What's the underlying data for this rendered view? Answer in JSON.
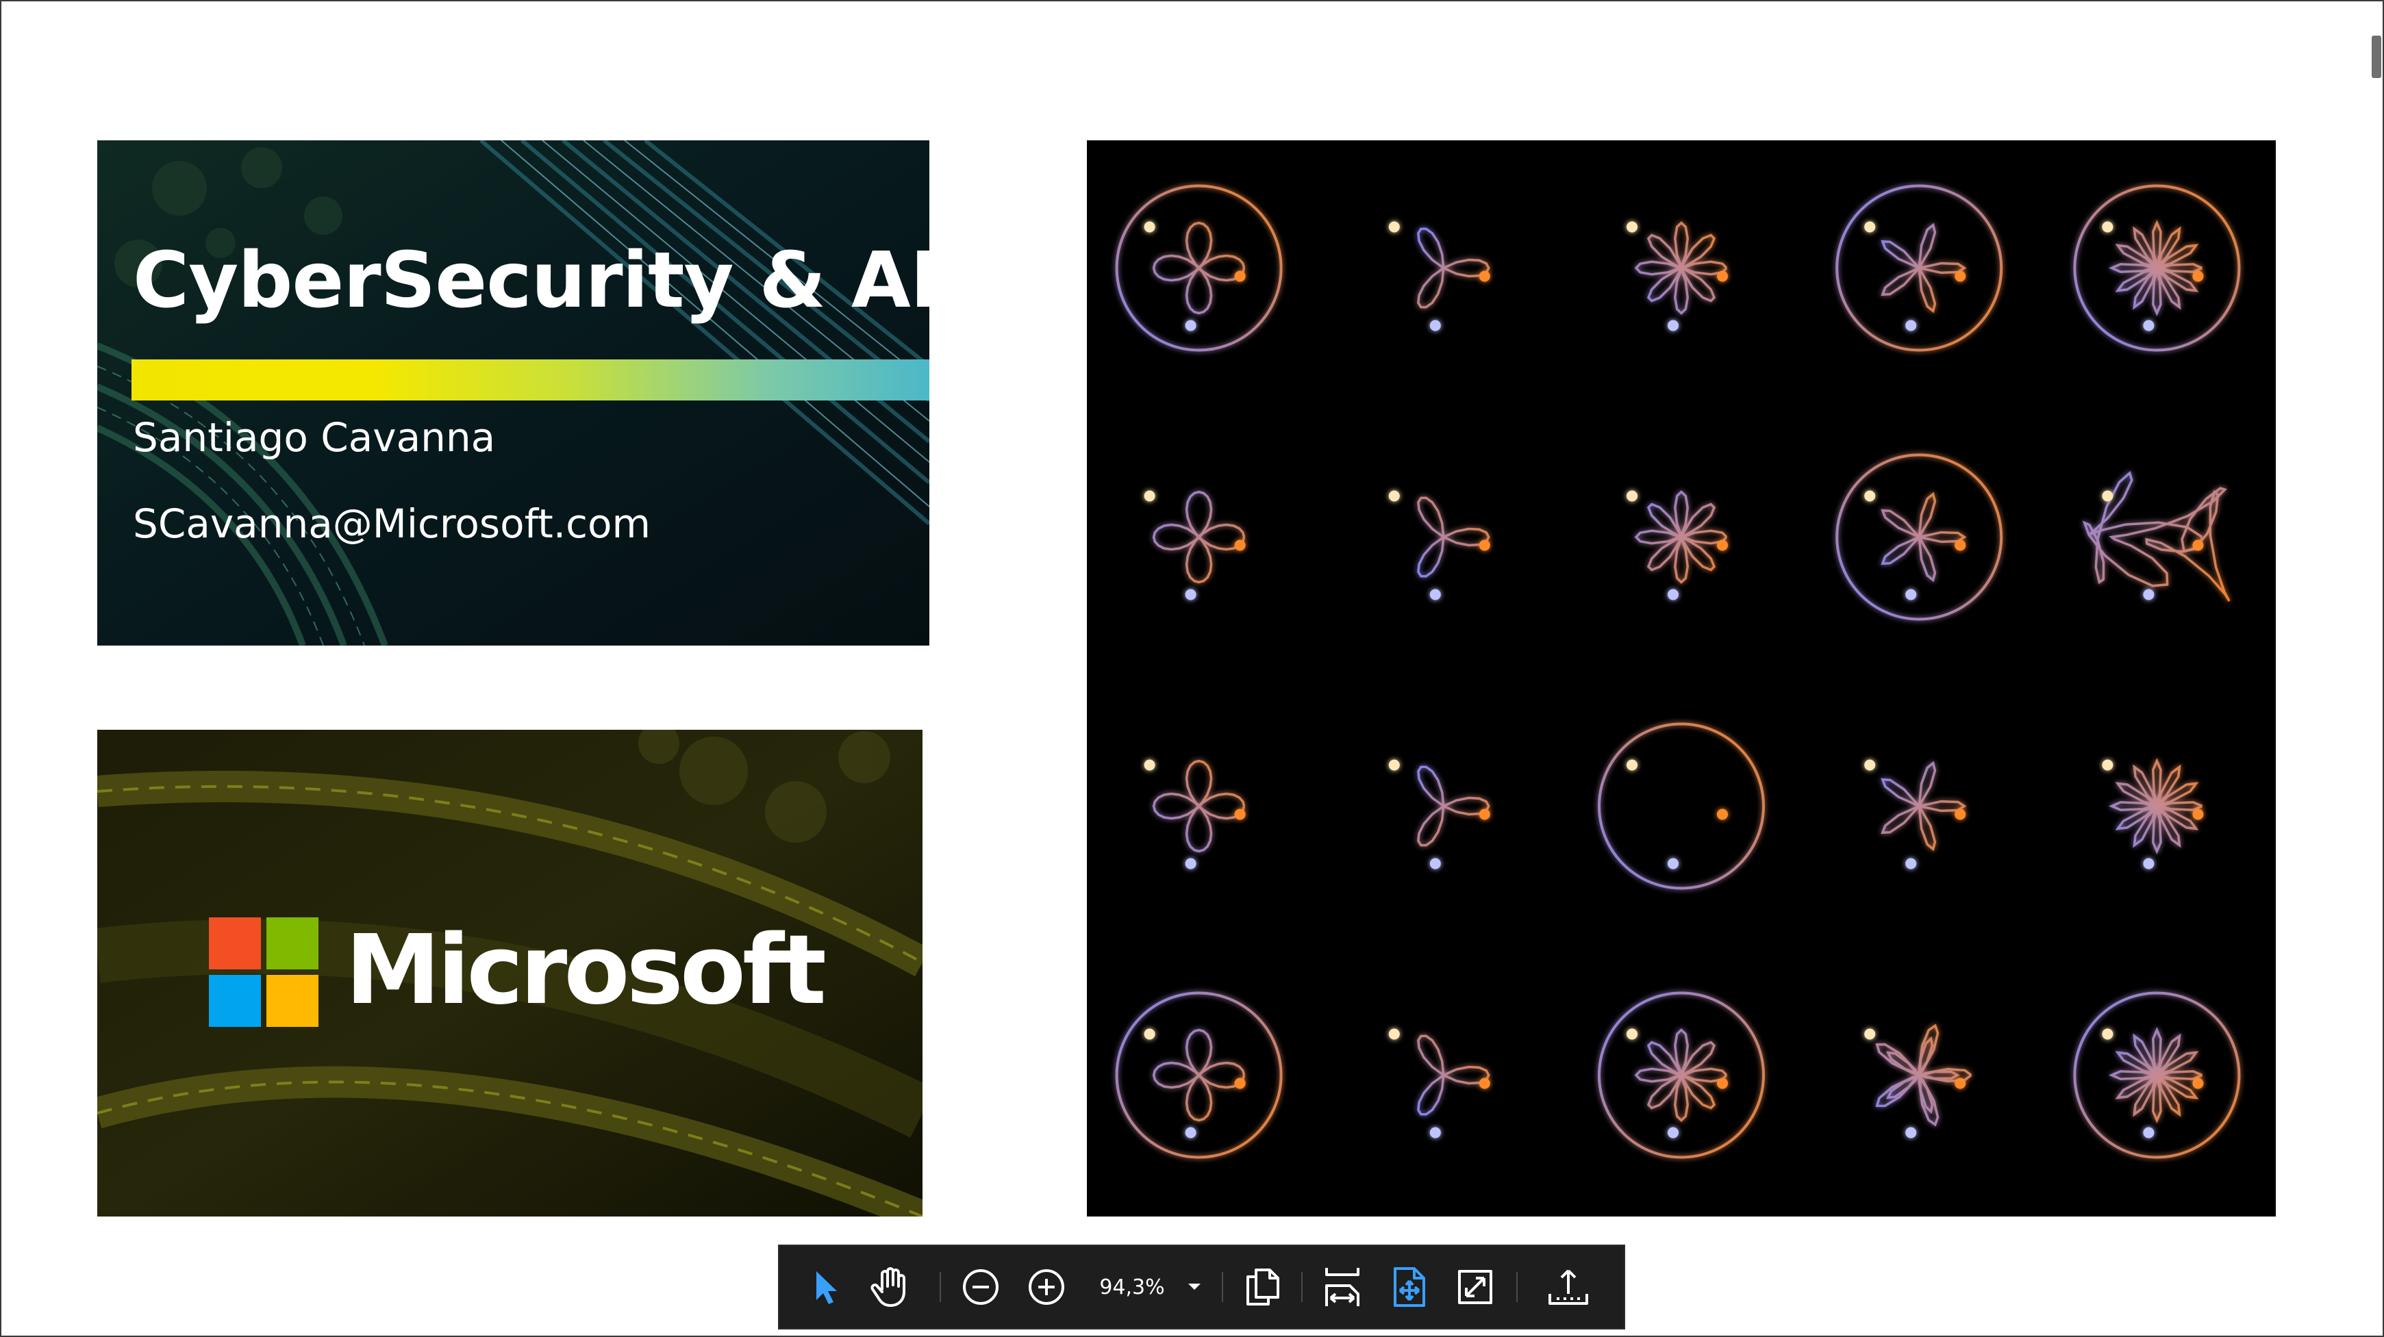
{
  "slide": {
    "title_card": {
      "title": "CyberSecurity & AI",
      "name": "Santiago Cavanna",
      "email": "SCavanna@Microsoft.com",
      "bar_gradient": [
        "#f2e600",
        "#c9e03a",
        "#4cb8c8"
      ]
    },
    "microsoft_card": {
      "wordmark": "Microsoft",
      "logo_colors": [
        "#f25022",
        "#7fba00",
        "#00a4ef",
        "#ffb900"
      ]
    },
    "orbits_panel": {
      "description_icon": "three-body-orbits-image",
      "rows": 4,
      "cols": 5
    }
  },
  "toolbar": {
    "zoom_value": "94,3%",
    "icons": [
      "select-pointer-icon",
      "pan-hand-icon",
      "zoom-out-icon",
      "zoom-in-icon",
      "zoom-dropdown-icon",
      "copy-pages-icon",
      "fit-width-icon",
      "fit-page-icon",
      "fullscreen-icon",
      "share-upload-icon"
    ],
    "accent": "#3aa0ff"
  }
}
